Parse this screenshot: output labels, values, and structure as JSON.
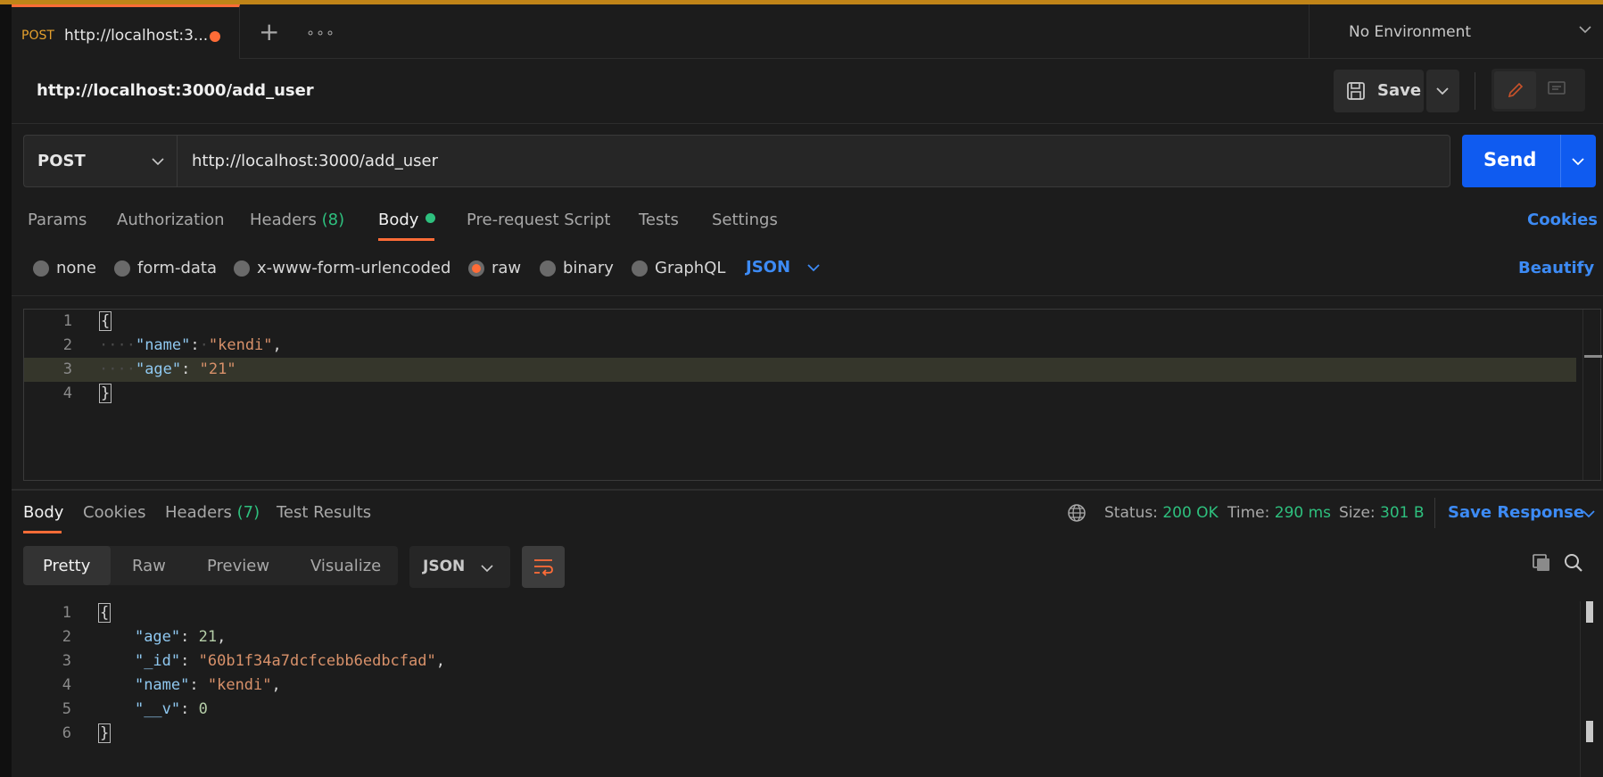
{
  "tab": {
    "method": "POST",
    "title": "http://localhost:3...",
    "unsaved": true
  },
  "environment": {
    "label": "No Environment"
  },
  "request": {
    "name": "http://localhost:3000/add_user",
    "method": "POST",
    "url": "http://localhost:3000/add_user",
    "save_label": "Save",
    "send_label": "Send"
  },
  "request_tabs": [
    {
      "label": "Params"
    },
    {
      "label": "Authorization"
    },
    {
      "label": "Headers",
      "count": "(8)"
    },
    {
      "label": "Body"
    },
    {
      "label": "Pre-request Script"
    },
    {
      "label": "Tests"
    },
    {
      "label": "Settings"
    }
  ],
  "cookies_label": "Cookies",
  "body_types": [
    {
      "label": "none"
    },
    {
      "label": "form-data"
    },
    {
      "label": "x-www-form-urlencoded"
    },
    {
      "label": "raw",
      "selected": true
    },
    {
      "label": "binary"
    },
    {
      "label": "GraphQL"
    }
  ],
  "body_format": "JSON",
  "beautify_label": "Beautify",
  "request_body": {
    "line_numbers": [
      "1",
      "2",
      "3",
      "4"
    ],
    "open": "{",
    "close": "}",
    "name_key": "\"name\"",
    "name_value": "\"kendi\"",
    "age_key": "\"age\"",
    "age_value": "\"21\""
  },
  "response_tabs": [
    {
      "label": "Body"
    },
    {
      "label": "Cookies"
    },
    {
      "label": "Headers",
      "count": "(7)"
    },
    {
      "label": "Test Results"
    }
  ],
  "response_stats": {
    "status_label": "Status:",
    "status_value": "200 OK",
    "time_label": "Time:",
    "time_value": "290 ms",
    "size_label": "Size:",
    "size_value": "301 B"
  },
  "save_response_label": "Save Response",
  "view_modes": [
    "Pretty",
    "Raw",
    "Preview",
    "Visualize"
  ],
  "response_format": "JSON",
  "response_body": {
    "line_numbers": [
      "1",
      "2",
      "3",
      "4",
      "5",
      "6"
    ],
    "open": "{",
    "close": "}",
    "age_key": "\"age\"",
    "age_value": "21",
    "id_key": "\"_id\"",
    "id_value": "\"60b1f34a7dcfcebb6edbcfad\"",
    "name_key": "\"name\"",
    "name_value": "\"kendi\"",
    "v_key": "\"__v\"",
    "v_value": "0"
  },
  "colors": {
    "accent_orange": "#ff6c37",
    "send_blue": "#0f5bf0",
    "link_blue": "#3d8bf5",
    "success_green": "#2ec07e",
    "top_border": "#c08418"
  }
}
